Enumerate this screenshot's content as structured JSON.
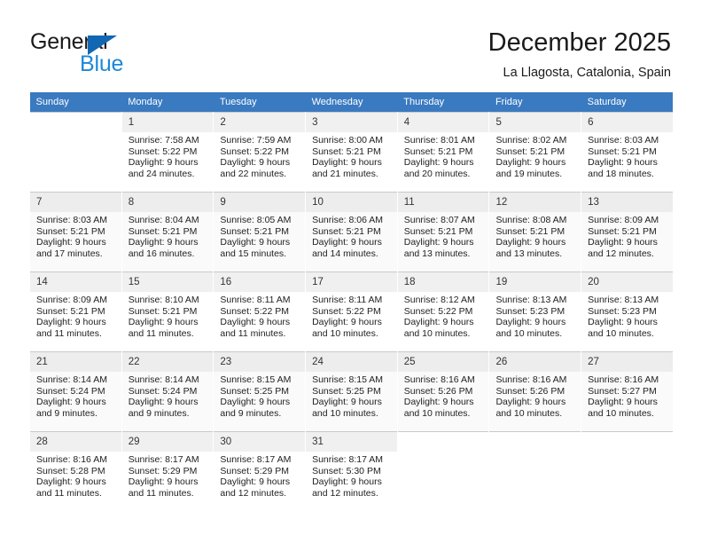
{
  "brand": {
    "name_part1": "General",
    "name_part2": "Blue",
    "flag_icon": "triangle-flag-icon"
  },
  "header": {
    "title": "December 2025",
    "subtitle": "La Llagosta, Catalonia, Spain"
  },
  "colors": {
    "header_row_bg": "#3a7ac0",
    "brand_dark": "#1a1a1a",
    "brand_blue": "#1e88d6",
    "daynum_bg": "#f0f0f0",
    "row_shaded_bg": "#fafafa",
    "grid_line": "#c9c9c9"
  },
  "calendar": {
    "weekday_headers": [
      "Sunday",
      "Monday",
      "Tuesday",
      "Wednesday",
      "Thursday",
      "Friday",
      "Saturday"
    ],
    "weeks": [
      [
        {
          "day": "",
          "sunrise": "",
          "sunset": "",
          "daylight_line1": "",
          "daylight_line2": ""
        },
        {
          "day": "1",
          "sunrise": "Sunrise: 7:58 AM",
          "sunset": "Sunset: 5:22 PM",
          "daylight_line1": "Daylight: 9 hours",
          "daylight_line2": "and 24 minutes."
        },
        {
          "day": "2",
          "sunrise": "Sunrise: 7:59 AM",
          "sunset": "Sunset: 5:22 PM",
          "daylight_line1": "Daylight: 9 hours",
          "daylight_line2": "and 22 minutes."
        },
        {
          "day": "3",
          "sunrise": "Sunrise: 8:00 AM",
          "sunset": "Sunset: 5:21 PM",
          "daylight_line1": "Daylight: 9 hours",
          "daylight_line2": "and 21 minutes."
        },
        {
          "day": "4",
          "sunrise": "Sunrise: 8:01 AM",
          "sunset": "Sunset: 5:21 PM",
          "daylight_line1": "Daylight: 9 hours",
          "daylight_line2": "and 20 minutes."
        },
        {
          "day": "5",
          "sunrise": "Sunrise: 8:02 AM",
          "sunset": "Sunset: 5:21 PM",
          "daylight_line1": "Daylight: 9 hours",
          "daylight_line2": "and 19 minutes."
        },
        {
          "day": "6",
          "sunrise": "Sunrise: 8:03 AM",
          "sunset": "Sunset: 5:21 PM",
          "daylight_line1": "Daylight: 9 hours",
          "daylight_line2": "and 18 minutes."
        }
      ],
      [
        {
          "day": "7",
          "sunrise": "Sunrise: 8:03 AM",
          "sunset": "Sunset: 5:21 PM",
          "daylight_line1": "Daylight: 9 hours",
          "daylight_line2": "and 17 minutes."
        },
        {
          "day": "8",
          "sunrise": "Sunrise: 8:04 AM",
          "sunset": "Sunset: 5:21 PM",
          "daylight_line1": "Daylight: 9 hours",
          "daylight_line2": "and 16 minutes."
        },
        {
          "day": "9",
          "sunrise": "Sunrise: 8:05 AM",
          "sunset": "Sunset: 5:21 PM",
          "daylight_line1": "Daylight: 9 hours",
          "daylight_line2": "and 15 minutes."
        },
        {
          "day": "10",
          "sunrise": "Sunrise: 8:06 AM",
          "sunset": "Sunset: 5:21 PM",
          "daylight_line1": "Daylight: 9 hours",
          "daylight_line2": "and 14 minutes."
        },
        {
          "day": "11",
          "sunrise": "Sunrise: 8:07 AM",
          "sunset": "Sunset: 5:21 PM",
          "daylight_line1": "Daylight: 9 hours",
          "daylight_line2": "and 13 minutes."
        },
        {
          "day": "12",
          "sunrise": "Sunrise: 8:08 AM",
          "sunset": "Sunset: 5:21 PM",
          "daylight_line1": "Daylight: 9 hours",
          "daylight_line2": "and 13 minutes."
        },
        {
          "day": "13",
          "sunrise": "Sunrise: 8:09 AM",
          "sunset": "Sunset: 5:21 PM",
          "daylight_line1": "Daylight: 9 hours",
          "daylight_line2": "and 12 minutes."
        }
      ],
      [
        {
          "day": "14",
          "sunrise": "Sunrise: 8:09 AM",
          "sunset": "Sunset: 5:21 PM",
          "daylight_line1": "Daylight: 9 hours",
          "daylight_line2": "and 11 minutes."
        },
        {
          "day": "15",
          "sunrise": "Sunrise: 8:10 AM",
          "sunset": "Sunset: 5:21 PM",
          "daylight_line1": "Daylight: 9 hours",
          "daylight_line2": "and 11 minutes."
        },
        {
          "day": "16",
          "sunrise": "Sunrise: 8:11 AM",
          "sunset": "Sunset: 5:22 PM",
          "daylight_line1": "Daylight: 9 hours",
          "daylight_line2": "and 11 minutes."
        },
        {
          "day": "17",
          "sunrise": "Sunrise: 8:11 AM",
          "sunset": "Sunset: 5:22 PM",
          "daylight_line1": "Daylight: 9 hours",
          "daylight_line2": "and 10 minutes."
        },
        {
          "day": "18",
          "sunrise": "Sunrise: 8:12 AM",
          "sunset": "Sunset: 5:22 PM",
          "daylight_line1": "Daylight: 9 hours",
          "daylight_line2": "and 10 minutes."
        },
        {
          "day": "19",
          "sunrise": "Sunrise: 8:13 AM",
          "sunset": "Sunset: 5:23 PM",
          "daylight_line1": "Daylight: 9 hours",
          "daylight_line2": "and 10 minutes."
        },
        {
          "day": "20",
          "sunrise": "Sunrise: 8:13 AM",
          "sunset": "Sunset: 5:23 PM",
          "daylight_line1": "Daylight: 9 hours",
          "daylight_line2": "and 10 minutes."
        }
      ],
      [
        {
          "day": "21",
          "sunrise": "Sunrise: 8:14 AM",
          "sunset": "Sunset: 5:24 PM",
          "daylight_line1": "Daylight: 9 hours",
          "daylight_line2": "and 9 minutes."
        },
        {
          "day": "22",
          "sunrise": "Sunrise: 8:14 AM",
          "sunset": "Sunset: 5:24 PM",
          "daylight_line1": "Daylight: 9 hours",
          "daylight_line2": "and 9 minutes."
        },
        {
          "day": "23",
          "sunrise": "Sunrise: 8:15 AM",
          "sunset": "Sunset: 5:25 PM",
          "daylight_line1": "Daylight: 9 hours",
          "daylight_line2": "and 9 minutes."
        },
        {
          "day": "24",
          "sunrise": "Sunrise: 8:15 AM",
          "sunset": "Sunset: 5:25 PM",
          "daylight_line1": "Daylight: 9 hours",
          "daylight_line2": "and 10 minutes."
        },
        {
          "day": "25",
          "sunrise": "Sunrise: 8:16 AM",
          "sunset": "Sunset: 5:26 PM",
          "daylight_line1": "Daylight: 9 hours",
          "daylight_line2": "and 10 minutes."
        },
        {
          "day": "26",
          "sunrise": "Sunrise: 8:16 AM",
          "sunset": "Sunset: 5:26 PM",
          "daylight_line1": "Daylight: 9 hours",
          "daylight_line2": "and 10 minutes."
        },
        {
          "day": "27",
          "sunrise": "Sunrise: 8:16 AM",
          "sunset": "Sunset: 5:27 PM",
          "daylight_line1": "Daylight: 9 hours",
          "daylight_line2": "and 10 minutes."
        }
      ],
      [
        {
          "day": "28",
          "sunrise": "Sunrise: 8:16 AM",
          "sunset": "Sunset: 5:28 PM",
          "daylight_line1": "Daylight: 9 hours",
          "daylight_line2": "and 11 minutes."
        },
        {
          "day": "29",
          "sunrise": "Sunrise: 8:17 AM",
          "sunset": "Sunset: 5:29 PM",
          "daylight_line1": "Daylight: 9 hours",
          "daylight_line2": "and 11 minutes."
        },
        {
          "day": "30",
          "sunrise": "Sunrise: 8:17 AM",
          "sunset": "Sunset: 5:29 PM",
          "daylight_line1": "Daylight: 9 hours",
          "daylight_line2": "and 12 minutes."
        },
        {
          "day": "31",
          "sunrise": "Sunrise: 8:17 AM",
          "sunset": "Sunset: 5:30 PM",
          "daylight_line1": "Daylight: 9 hours",
          "daylight_line2": "and 12 minutes."
        },
        {
          "day": "",
          "sunrise": "",
          "sunset": "",
          "daylight_line1": "",
          "daylight_line2": ""
        },
        {
          "day": "",
          "sunrise": "",
          "sunset": "",
          "daylight_line1": "",
          "daylight_line2": ""
        },
        {
          "day": "",
          "sunrise": "",
          "sunset": "",
          "daylight_line1": "",
          "daylight_line2": ""
        }
      ]
    ]
  }
}
